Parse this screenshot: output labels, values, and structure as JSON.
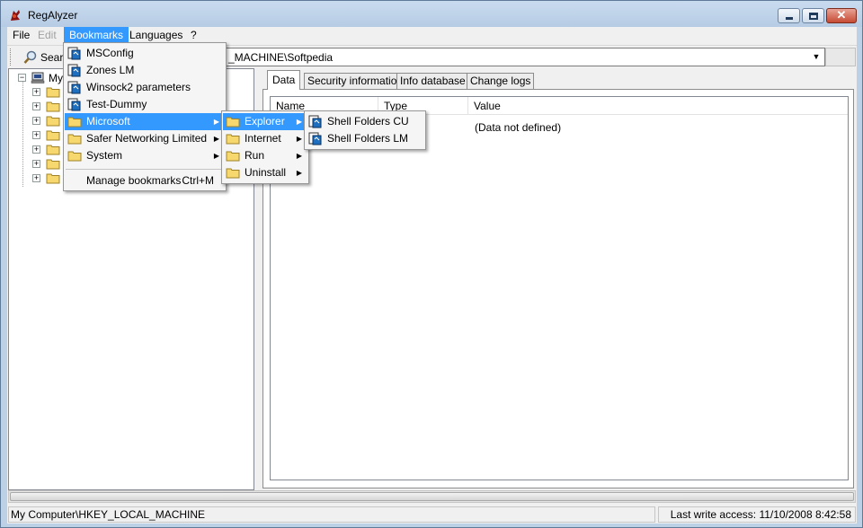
{
  "window": {
    "title": "RegAlyzer"
  },
  "menubar": [
    {
      "label": "File",
      "state": "normal"
    },
    {
      "label": "Edit",
      "state": "disabled"
    },
    {
      "label": "Bookmarks",
      "state": "active"
    },
    {
      "label": "Languages",
      "state": "normal"
    },
    {
      "label": "?",
      "state": "normal"
    }
  ],
  "toolbar": {
    "search_label": "Searc",
    "path_value": "_MACHINE\\Softpedia"
  },
  "tree": {
    "root_label": "My"
  },
  "tabs": [
    {
      "label": "Data",
      "active": true
    },
    {
      "label": "Security information",
      "active": false
    },
    {
      "label": "Info database",
      "active": false
    },
    {
      "label": "Change logs",
      "active": false
    }
  ],
  "list": {
    "columns": [
      "Name",
      "Type",
      "Value"
    ],
    "rows": [
      {
        "value": "(Data not defined)"
      }
    ]
  },
  "bookmarks_menu": {
    "items": [
      {
        "label": "MSConfig",
        "icon": "registry-key-icon"
      },
      {
        "label": "Zones LM",
        "icon": "registry-key-icon"
      },
      {
        "label": "Winsock2 parameters",
        "icon": "registry-key-icon"
      },
      {
        "label": "Test-Dummy",
        "icon": "registry-key-icon"
      },
      {
        "label": "Microsoft",
        "icon": "folder-icon",
        "submenu": true
      },
      {
        "label": "Safer Networking Limited",
        "icon": "folder-icon",
        "submenu": true
      },
      {
        "label": "System",
        "icon": "folder-icon",
        "submenu": true
      }
    ],
    "manage_label": "Manage bookmarks",
    "manage_shortcut": "Ctrl+M"
  },
  "microsoft_menu": {
    "items": [
      {
        "label": "Explorer",
        "submenu": true
      },
      {
        "label": "Internet",
        "submenu": true
      },
      {
        "label": "Run",
        "submenu": true
      },
      {
        "label": "Uninstall",
        "submenu": true
      }
    ]
  },
  "explorer_menu": {
    "items": [
      {
        "label": "Shell Folders CU"
      },
      {
        "label": "Shell Folders LM"
      }
    ]
  },
  "statusbar": {
    "left": "My Computer\\HKEY_LOCAL_MACHINE",
    "right": "Last write access: 11/10/2008 8:42:58"
  },
  "colors": {
    "highlight": "#3399ff",
    "title_bg": "#bcd0e6",
    "close_btn": "#c64a33"
  }
}
